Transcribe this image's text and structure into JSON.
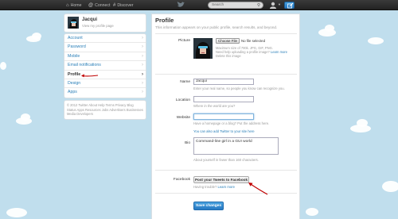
{
  "topbar": {
    "home": "Home",
    "connect": "Connect",
    "discover": "Discover",
    "search_placeholder": "Search"
  },
  "sidebar": {
    "user_name": "Jacqui",
    "view_profile": "View my profile page",
    "items": [
      {
        "label": "Account"
      },
      {
        "label": "Password"
      },
      {
        "label": "Mobile"
      },
      {
        "label": "Email notifications"
      },
      {
        "label": "Profile"
      },
      {
        "label": "Design"
      },
      {
        "label": "Apps"
      }
    ],
    "active_index": 4,
    "footer": "© 2012 Twitter About Help Terms Privacy Blog Status Apps Resources Jobs Advertisers Businesses Media Developers"
  },
  "profile": {
    "title": "Profile",
    "subtitle": "This information appears on your public profile, search results, and beyond.",
    "picture_label": "Picture",
    "choose_file": "Choose File",
    "no_file": "No file selected",
    "picture_info_1": "Maximum size of 700k. JPG, GIF, PNG.",
    "picture_info_2": "Need help uploading a profile image?",
    "picture_info_2_link": "Learn more",
    "delete_image": "Delete this image",
    "name_label": "Name",
    "name_value": "Jacqui",
    "name_hint": "Enter your real name, so people you know can recognize you.",
    "location_label": "Location",
    "location_value": "",
    "location_hint": "Where in the world are you?",
    "website_label": "Website",
    "website_value": "",
    "website_hint": "Have a homepage or a blog? Put the address here.",
    "website_hint_2": "You can also add Twitter to your site here",
    "bio_label": "Bio",
    "bio_value": "Command-line girl in a GUI world",
    "bio_hint": "About yourself in fewer than 160 characters.",
    "facebook_label": "Facebook",
    "facebook_button": "Post your Tweets to Facebook",
    "facebook_help": "Having trouble?",
    "facebook_help_link": "Learn more",
    "save_button": "Save changes"
  },
  "colors": {
    "background": "#c0deed",
    "link": "#2a7fb8",
    "primary_button": "#2779c2",
    "annotation_arrow": "#c00000"
  }
}
